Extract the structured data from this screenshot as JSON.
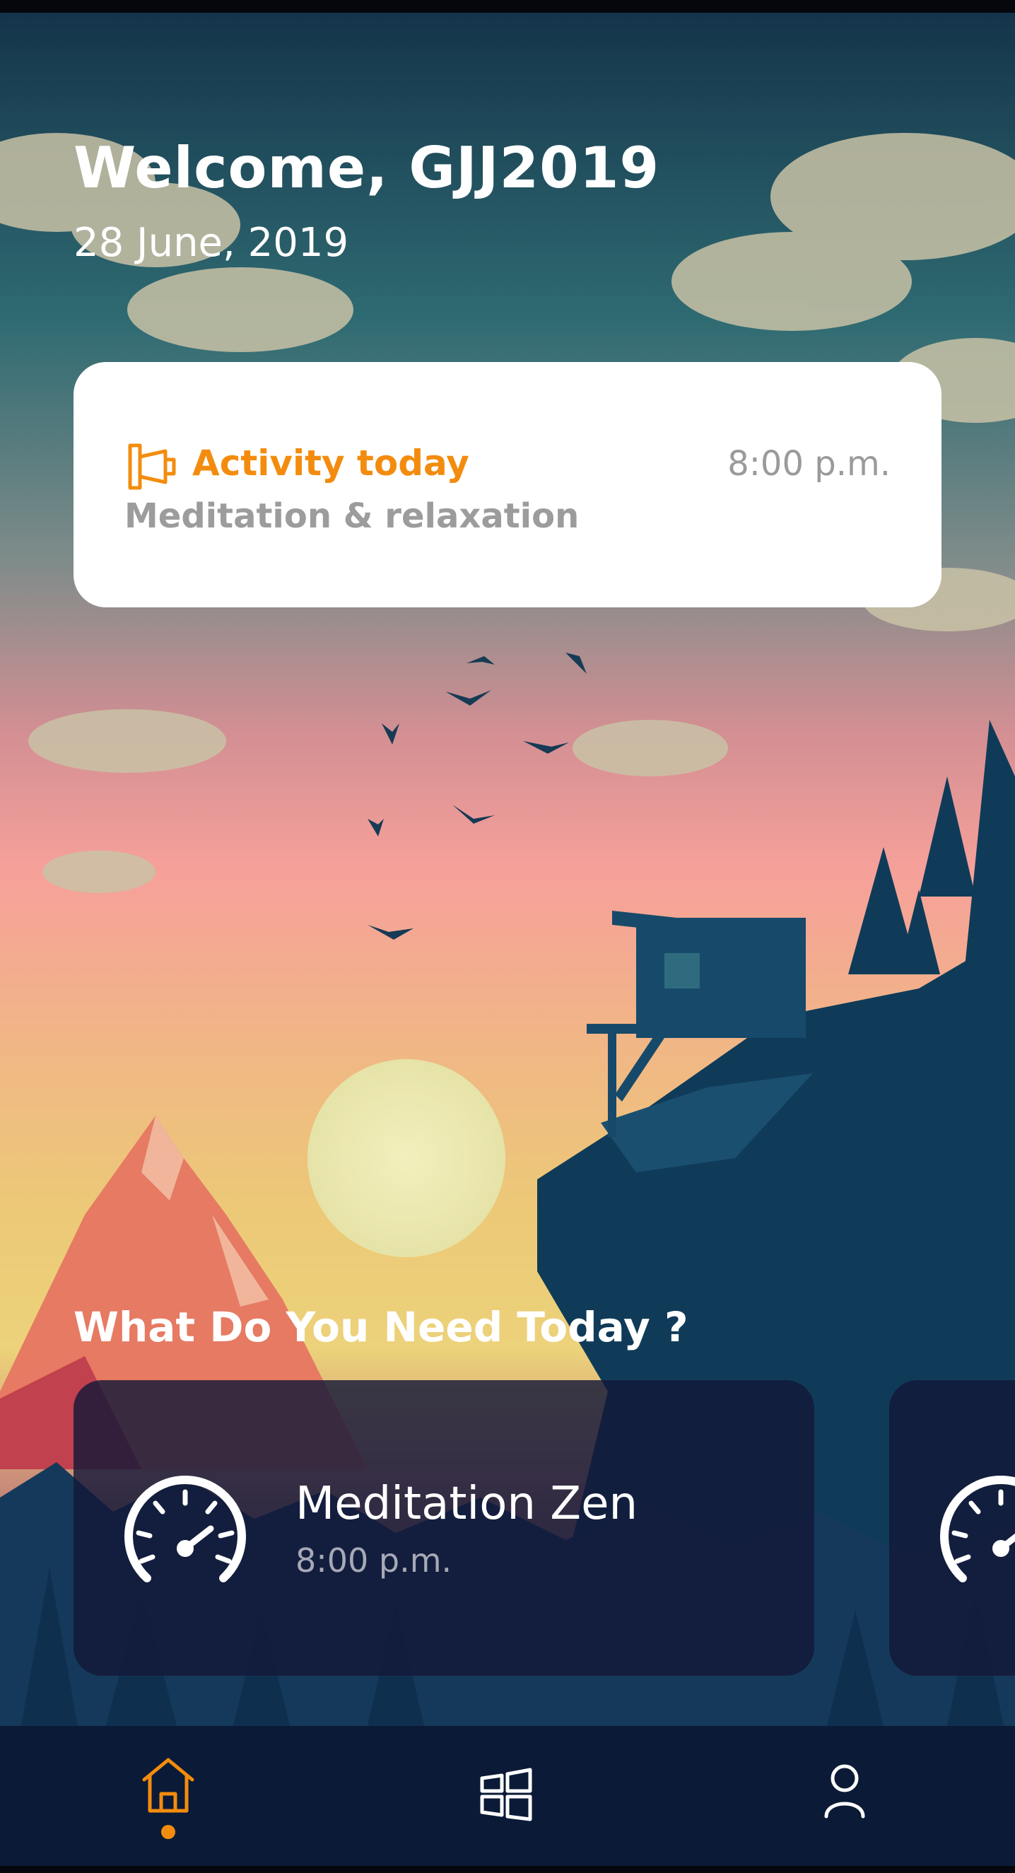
{
  "header": {
    "welcome": "Welcome, GJJ2019",
    "date": "28 June, 2019"
  },
  "activity_card": {
    "icon": "megaphone-icon",
    "title": "Activity today",
    "time": "8:00 p.m.",
    "subtitle": "Meditation & relaxation"
  },
  "section": {
    "title": "What Do You Need Today ?"
  },
  "carousel": {
    "items": [
      {
        "icon": "speedometer-icon",
        "title": "Meditation Zen",
        "time": "8:00 p.m."
      },
      {
        "icon": "speedometer-icon",
        "title": "",
        "time": ""
      }
    ]
  },
  "bottom_nav": {
    "items": [
      {
        "icon": "home-icon",
        "active": true
      },
      {
        "icon": "grid-icon",
        "active": false
      },
      {
        "icon": "profile-icon",
        "active": false
      }
    ]
  },
  "colors": {
    "accent": "#f38c0e",
    "card_bg": "#ffffff",
    "nav_bg": "#0b1a36",
    "muted_text": "#9a9a9a"
  }
}
